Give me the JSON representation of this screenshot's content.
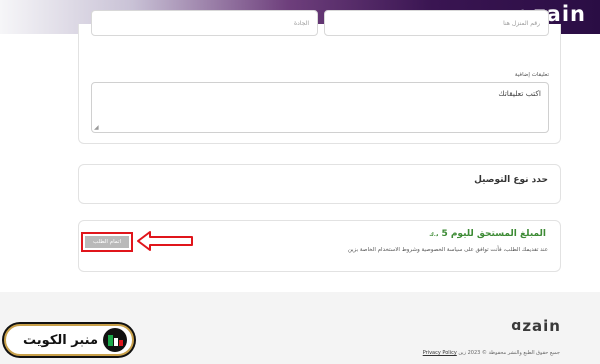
{
  "header": {
    "brand_mark": "ɑ",
    "brand_name": "zain"
  },
  "form": {
    "house_placeholder": "رقم المنزل هنا",
    "street_placeholder": "الجادة",
    "comments_label": "تعليقات إضافية",
    "comments_placeholder": "اكتب تعليقاتك",
    "resize_glyph": "◢"
  },
  "delivery": {
    "title": "حدد نوع التوصيل"
  },
  "amount": {
    "title": "المبلغ المستحق لليوم 5",
    "currency": "د.ك",
    "consent": "عند تقديمك الطلب، فأنت توافق على سياسة الخصوصية وشروط الاستخدام الخاصة بزين"
  },
  "actions": {
    "complete_label": "اتمام الطلب"
  },
  "colors": {
    "accent_green": "#3d8b35",
    "highlight_red": "#e0151b",
    "header_purple": "#2a0d44"
  },
  "footer": {
    "brand_mark": "ɑ",
    "brand_name": "zain",
    "rights": "جميع حقوق الطبع والنشر محفوظة © 2023 زين",
    "privacy": "Privacy Policy"
  },
  "watermark": {
    "text": "منبر الكويت"
  }
}
